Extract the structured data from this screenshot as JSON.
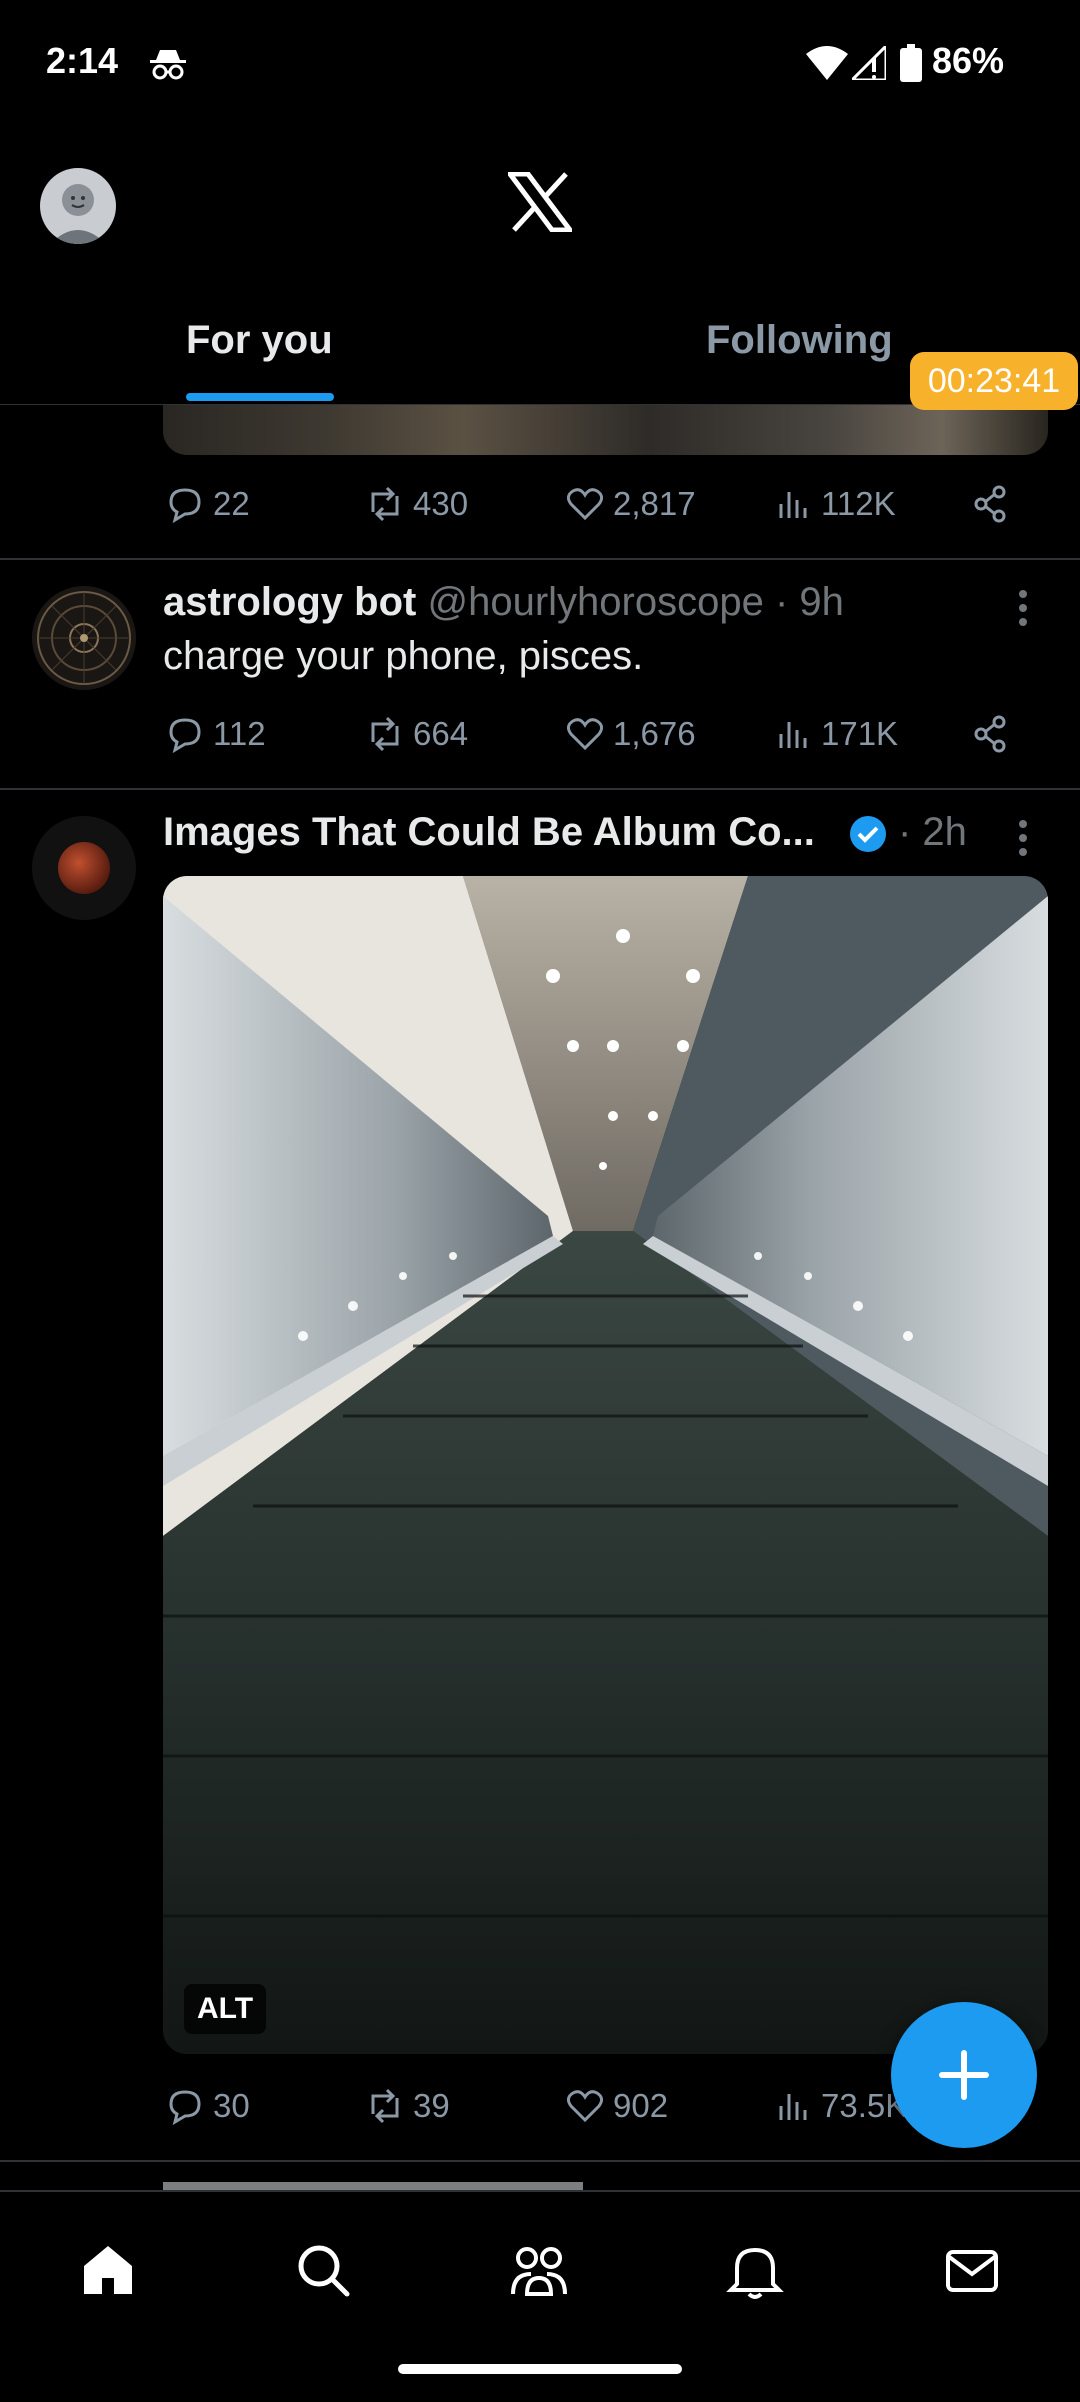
{
  "status_bar": {
    "time": "2:14",
    "battery": "86%",
    "icons": [
      "incognito-icon",
      "wifi-icon",
      "signal-icon",
      "battery-icon"
    ]
  },
  "header": {
    "logo": "X",
    "tabs": [
      {
        "label": "For you",
        "active": true
      },
      {
        "label": "Following",
        "active": false
      }
    ],
    "accent_color": "#1d9bf0"
  },
  "timer_badge": "00:23:41",
  "feed": {
    "top_tweet_actions": {
      "replies": "22",
      "reposts": "430",
      "likes": "2,817",
      "views": "112K"
    },
    "tweets": [
      {
        "name": "astrology bot",
        "handle": "@hourlyhoroscope",
        "time": "· 9h",
        "text": "charge your phone, pisces.",
        "replies": "112",
        "reposts": "664",
        "likes": "1,676",
        "views": "171K"
      },
      {
        "name": "Images That Could Be Album Co...",
        "verified": true,
        "time": "· 2h",
        "media_alt_label": "ALT",
        "replies": "30",
        "reposts": "39",
        "likes": "902",
        "views": "73.5K"
      }
    ]
  },
  "bottom_nav": [
    "home-icon",
    "search-icon",
    "communities-icon",
    "notifications-icon",
    "messages-icon"
  ]
}
